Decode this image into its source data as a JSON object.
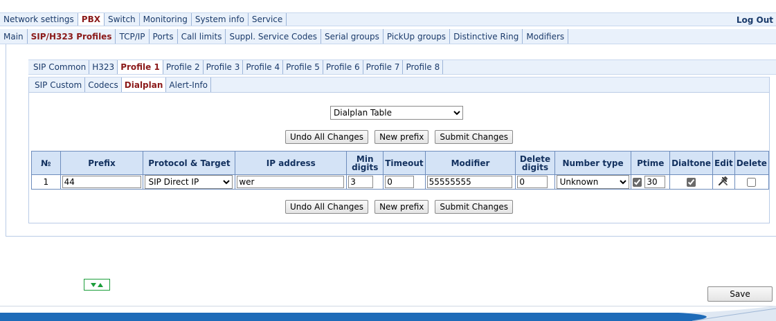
{
  "top_menu": {
    "items": [
      "Network settings",
      "PBX",
      "Switch",
      "Monitoring",
      "System info",
      "Service"
    ],
    "active_index": 1,
    "logout": "Log Out"
  },
  "sub_menu": {
    "items": [
      "Main",
      "SIP/H323 Profiles",
      "TCP/IP",
      "Ports",
      "Call limits",
      "Suppl. Service Codes",
      "Serial groups",
      "PickUp groups",
      "Distinctive Ring",
      "Modifiers"
    ],
    "active_index": 1
  },
  "profile_tabs": {
    "items": [
      "SIP Common",
      "H323",
      "Profile 1",
      "Profile 2",
      "Profile 3",
      "Profile 4",
      "Profile 5",
      "Profile 6",
      "Profile 7",
      "Profile 8"
    ],
    "active_index": 2
  },
  "dial_tabs": {
    "items": [
      "SIP Custom",
      "Codecs",
      "Dialplan",
      "Alert-Info"
    ],
    "active_index": 2
  },
  "view_select": {
    "value": "Dialplan Table"
  },
  "buttons": {
    "undo": "Undo All Changes",
    "new_prefix": "New prefix",
    "submit": "Submit Changes",
    "save": "Save"
  },
  "table": {
    "headers": [
      "№",
      "Prefix",
      "Protocol & Target",
      "IP address",
      "Min digits",
      "Timeout",
      "Modifier",
      "Delete digits",
      "Number type",
      "Ptime",
      "Dialtone",
      "Edit",
      "Delete"
    ],
    "row": {
      "num": "1",
      "prefix": "44",
      "protocol": "SIP Direct IP",
      "ip": "wer",
      "min_digits": "3",
      "timeout": "0",
      "modifier": "55555555",
      "delete_digits": "0",
      "number_type": "Unknown",
      "ptime_checked": true,
      "ptime": "30",
      "dialtone_checked": true,
      "delete_checked": false
    }
  },
  "colors": {
    "accent": "#8b1a1a",
    "tab_bg": "#e9f1fb",
    "header_bg": "#d4e3f6",
    "border": "#6d8cbc",
    "footer": "#1e6bb8"
  }
}
